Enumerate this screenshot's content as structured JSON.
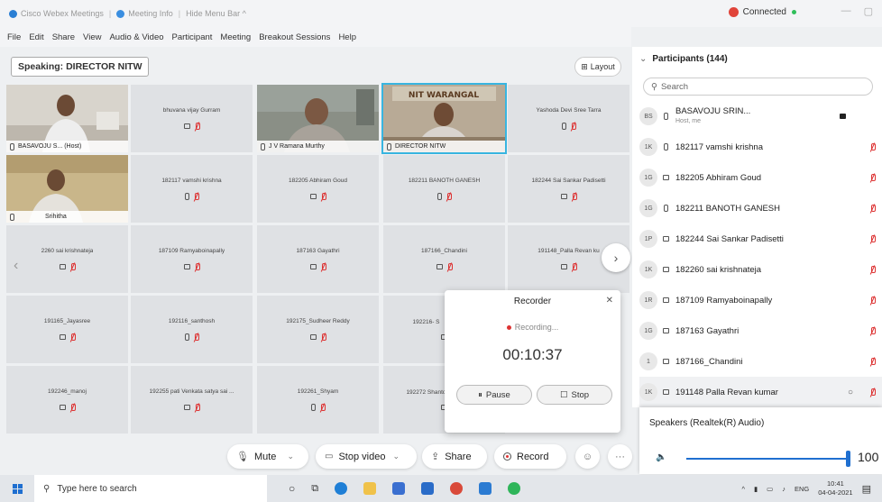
{
  "titlebar": {
    "app_name": "Cisco Webex Meetings",
    "meeting_info": "Meeting Info",
    "hide_menu": "Hide Menu Bar ^",
    "connected": "Connected",
    "win_min": "—",
    "win_max": "▢"
  },
  "menu": [
    "File",
    "Edit",
    "Share",
    "View",
    "Audio & Video",
    "Participant",
    "Meeting",
    "Breakout Sessions",
    "Help"
  ],
  "speaking_label": "Speaking: DIRECTOR NITW",
  "layout_label": "Layout",
  "video_tiles": [
    {
      "name": "BASAVOJU S... (Host)"
    },
    {
      "name": "J V Ramana Murthy"
    },
    {
      "name": "DIRECTOR NITW",
      "sign": "NIT WARANGAL"
    },
    {
      "name": "Srihitha"
    }
  ],
  "tiles": [
    {
      "name": "bhuvana vijay Gurram"
    },
    {
      "name": "Yashoda Devi Sree Tarra"
    },
    {
      "name": "182117 vamshi krishna"
    },
    {
      "name": "182205 Abhiram Goud"
    },
    {
      "name": "182211 BANOTH GANESH"
    },
    {
      "name": "182244 Sai Sankar Padisetti"
    },
    {
      "name": "2260 sai krishnateja"
    },
    {
      "name": "187109 Ramyaboinapally"
    },
    {
      "name": "187163 Gayathri"
    },
    {
      "name": "187166_Chandini"
    },
    {
      "name": "191148_Palla Revan ku"
    },
    {
      "name": "191165_Jayasree"
    },
    {
      "name": "192116_santhosh"
    },
    {
      "name": "192175_Sudheer Reddy"
    },
    {
      "name": "192216- S"
    },
    {
      "name": "192246_manoj"
    },
    {
      "name": "192255 pati Venkata satya sai ..."
    },
    {
      "name": "192261_Shyam"
    },
    {
      "name": "192272 Shanto"
    }
  ],
  "recorder": {
    "title": "Recorder",
    "status": "Recording...",
    "time": "00:10:37",
    "pause": "Pause",
    "stop": "Stop"
  },
  "controls": {
    "mute": "Mute",
    "stop_video": "Stop video",
    "share": "Share",
    "record": "Record"
  },
  "participants": {
    "header": "Participants (144)",
    "search_placeholder": "Search",
    "host_sub": "Host, me",
    "rows": [
      {
        "initials": "BS",
        "name": "BASAVOJU SRIN..."
      },
      {
        "initials": "1K",
        "name": "182117 vamshi krishna"
      },
      {
        "initials": "1G",
        "name": "182205 Abhiram Goud"
      },
      {
        "initials": "1G",
        "name": "182211 BANOTH GANESH"
      },
      {
        "initials": "1P",
        "name": "182244 Sai Sankar Padisetti"
      },
      {
        "initials": "1K",
        "name": "182260 sai krishnateja"
      },
      {
        "initials": "1R",
        "name": "187109 Ramyaboinapally"
      },
      {
        "initials": "1G",
        "name": "187163 Gayathri"
      },
      {
        "initials": "1",
        "name": "187166_Chandini"
      },
      {
        "initials": "1K",
        "name": "191148 Palla Revan kumar"
      }
    ]
  },
  "speakers": {
    "title": "Speakers (Realtek(R) Audio)",
    "volume": "100"
  },
  "taskbar": {
    "search_placeholder": "Type here to search",
    "lang": "ENG",
    "time": "10:41",
    "date": "04-04-2021"
  }
}
